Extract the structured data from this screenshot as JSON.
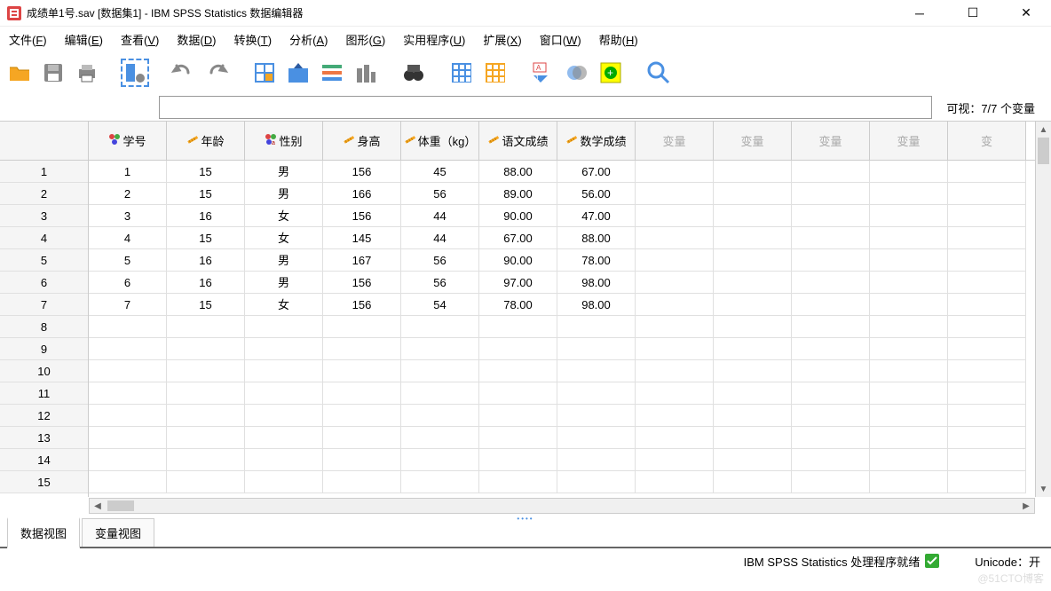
{
  "window": {
    "title": "成绩单1号.sav [数据集1] - IBM SPSS Statistics 数据编辑器"
  },
  "menu": {
    "file": "文件(F)",
    "edit": "编辑(E)",
    "view": "查看(V)",
    "data": "数据(D)",
    "transform": "转换(T)",
    "analyze": "分析(A)",
    "graphs": "图形(G)",
    "utilities": "实用程序(U)",
    "extensions": "扩展(X)",
    "window": "窗口(W)",
    "help": "帮助(H)"
  },
  "visible_label": "可视：7/7 个变量",
  "columns": [
    {
      "label": "学号",
      "icon": "nominal"
    },
    {
      "label": "年龄",
      "icon": "scale"
    },
    {
      "label": "性别",
      "icon": "nominal-str"
    },
    {
      "label": "身高",
      "icon": "scale"
    },
    {
      "label": "体重（kg）",
      "icon": "scale"
    },
    {
      "label": "语文成绩",
      "icon": "scale"
    },
    {
      "label": "数学成绩",
      "icon": "scale"
    }
  ],
  "empty_col_label": "变量",
  "rows": [
    [
      "1",
      "15",
      "男",
      "156",
      "45",
      "88.00",
      "67.00"
    ],
    [
      "2",
      "15",
      "男",
      "166",
      "56",
      "89.00",
      "56.00"
    ],
    [
      "3",
      "16",
      "女",
      "156",
      "44",
      "90.00",
      "47.00"
    ],
    [
      "4",
      "15",
      "女",
      "145",
      "44",
      "67.00",
      "88.00"
    ],
    [
      "5",
      "16",
      "男",
      "167",
      "56",
      "90.00",
      "78.00"
    ],
    [
      "6",
      "16",
      "男",
      "156",
      "56",
      "97.00",
      "98.00"
    ],
    [
      "7",
      "15",
      "女",
      "156",
      "54",
      "78.00",
      "98.00"
    ]
  ],
  "row_count_visible": 15,
  "tabs": {
    "data_view": "数据视图",
    "variable_view": "变量视图"
  },
  "status": {
    "processor": "IBM SPSS Statistics 处理程序就绪",
    "unicode": "Unicode：开"
  },
  "watermark": "@51CTO博客"
}
